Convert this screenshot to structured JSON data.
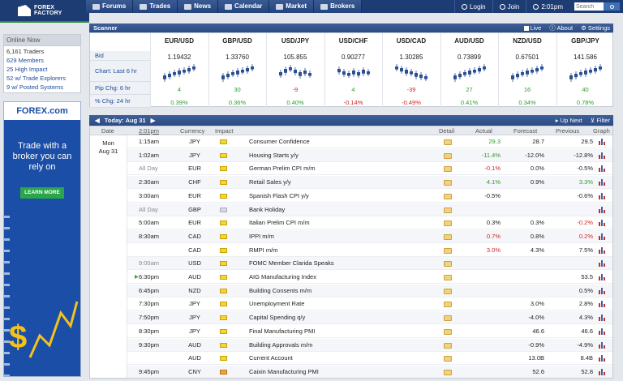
{
  "brand": {
    "line1": "FOREX",
    "line2": "FACTORY"
  },
  "nav": [
    {
      "label": "Forums",
      "icon": "forums-icon"
    },
    {
      "label": "Trades",
      "icon": "trades-icon"
    },
    {
      "label": "News",
      "icon": "news-icon"
    },
    {
      "label": "Calendar",
      "icon": "calendar-icon"
    },
    {
      "label": "Market",
      "icon": "market-icon"
    },
    {
      "label": "Brokers",
      "icon": "brokers-icon"
    }
  ],
  "topright": {
    "login": "Login",
    "join": "Join",
    "time": "2:01pm",
    "search_placeholder": "Search"
  },
  "online": {
    "heading": "Online Now",
    "items": [
      "6,161 Traders",
      "629 Members",
      "25 High Impact",
      "52 w/ Trade Explorers",
      "9 w/ Posted Systems"
    ]
  },
  "ad": {
    "brand": "FOREX.com",
    "text": "Trade with a broker you can rely on",
    "button": "LEARN MORE",
    "dollar": "$"
  },
  "scanner": {
    "title": "Scanner",
    "tools": [
      "Live",
      "About",
      "Settings"
    ],
    "row_labels": [
      "Bid",
      "Chart: Last 6 hr",
      "Pip Chg: 6 hr",
      "% Chg: 24 hr"
    ],
    "pairs": [
      {
        "name": "EUR/USD",
        "bid": "1.19432",
        "pip": "4",
        "pct": "0.39%",
        "dir": "pos"
      },
      {
        "name": "GBP/USD",
        "bid": "1.33760",
        "pip": "30",
        "pct": "0.36%",
        "dir": "pos"
      },
      {
        "name": "USD/JPY",
        "bid": "105.855",
        "pip": "-9",
        "pct": "0.40%",
        "dir": "mix"
      },
      {
        "name": "USD/CHF",
        "bid": "0.90277",
        "pip": "4",
        "pct": "-0.14%",
        "dir": "mix2"
      },
      {
        "name": "USD/CAD",
        "bid": "1.30285",
        "pip": "-39",
        "pct": "-0.49%",
        "dir": "neg"
      },
      {
        "name": "AUD/USD",
        "bid": "0.73899",
        "pip": "27",
        "pct": "0.41%",
        "dir": "pos"
      },
      {
        "name": "NZD/USD",
        "bid": "0.67501",
        "pip": "16",
        "pct": "0.34%",
        "dir": "pos"
      },
      {
        "name": "GBP/JPY",
        "bid": "141.586",
        "pip": "40",
        "pct": "0.78%",
        "dir": "pos"
      }
    ]
  },
  "calendar": {
    "today_label": "Today: Aug 31",
    "tools": [
      "Up Next",
      "Filter"
    ],
    "headers": {
      "date": "Date",
      "time": "2:01pm",
      "currency": "Currency",
      "impact": "Impact",
      "detail": "Detail",
      "actual": "Actual",
      "forecast": "Forecast",
      "previous": "Previous",
      "graph": "Graph"
    },
    "day": {
      "weekday": "Mon",
      "date": "Aug 31"
    },
    "rows": [
      {
        "time": "1:15am",
        "cur": "JPY",
        "imp": "med",
        "event": "Consumer Confidence",
        "actual": "29.3",
        "actual_dir": "pos",
        "forecast": "28.7",
        "previous": "29.5",
        "prev_dir": "",
        "detail": "open"
      },
      {
        "time": "1:02am",
        "cur": "JPY",
        "imp": "med",
        "event": "Housing Starts y/y",
        "actual": "-11.4%",
        "actual_dir": "pos",
        "forecast": "-12.0%",
        "previous": "-12.8%",
        "prev_dir": "",
        "detail": "alert"
      },
      {
        "time": "All Day",
        "cur": "EUR",
        "imp": "med",
        "event": "German Prelim CPI m/m",
        "actual": "-0.1%",
        "actual_dir": "neg",
        "forecast": "0.0%",
        "previous": "-0.5%",
        "prev_dir": "",
        "detail": "open"
      },
      {
        "time": "2:30am",
        "cur": "CHF",
        "imp": "med",
        "event": "Retail Sales y/y",
        "actual": "4.1%",
        "actual_dir": "pos",
        "forecast": "0.9%",
        "previous": "3.3%",
        "prev_dir": "pos",
        "detail": "open"
      },
      {
        "time": "3:00am",
        "cur": "EUR",
        "imp": "med",
        "event": "Spanish Flash CPI y/y",
        "actual": "-0.5%",
        "actual_dir": "",
        "forecast": "",
        "previous": "-0.6%",
        "prev_dir": "",
        "detail": "open"
      },
      {
        "time": "All Day",
        "cur": "GBP",
        "imp": "low",
        "event": "Bank Holiday",
        "actual": "",
        "actual_dir": "",
        "forecast": "",
        "previous": "",
        "prev_dir": "",
        "detail": "open"
      },
      {
        "time": "5:00am",
        "cur": "EUR",
        "imp": "med",
        "event": "Italian Prelim CPI m/m",
        "actual": "0.3%",
        "actual_dir": "",
        "forecast": "0.3%",
        "previous": "-0.2%",
        "prev_dir": "neg",
        "detail": "open"
      },
      {
        "time": "8:30am",
        "cur": "CAD",
        "imp": "med",
        "event": "IPPI m/m",
        "actual": "0.7%",
        "actual_dir": "neg",
        "forecast": "0.8%",
        "previous": "0.2%",
        "prev_dir": "neg",
        "detail": "open"
      },
      {
        "time": "",
        "cur": "CAD",
        "imp": "med",
        "event": "RMPI m/m",
        "actual": "3.0%",
        "actual_dir": "neg",
        "forecast": "4.3%",
        "previous": "7.5%",
        "prev_dir": "",
        "detail": "open"
      },
      {
        "time": "9:00am",
        "cur": "USD",
        "imp": "med",
        "event": "FOMC Member Clarida Speaks",
        "actual": "",
        "actual_dir": "",
        "forecast": "",
        "previous": "",
        "prev_dir": "",
        "detail": "open"
      },
      {
        "time": "6:30pm",
        "cur": "AUD",
        "imp": "med",
        "event": "AIG Manufacturing Index",
        "actual": "",
        "actual_dir": "",
        "forecast": "",
        "previous": "53.5",
        "prev_dir": "",
        "detail": "open",
        "next": true
      },
      {
        "time": "6:45pm",
        "cur": "NZD",
        "imp": "med",
        "event": "Building Consents m/m",
        "actual": "",
        "actual_dir": "",
        "forecast": "",
        "previous": "0.5%",
        "prev_dir": "",
        "detail": "open"
      },
      {
        "time": "7:30pm",
        "cur": "JPY",
        "imp": "med",
        "event": "Unemployment Rate",
        "actual": "",
        "actual_dir": "",
        "forecast": "3.0%",
        "previous": "2.8%",
        "prev_dir": "",
        "detail": "open"
      },
      {
        "time": "7:50pm",
        "cur": "JPY",
        "imp": "med",
        "event": "Capital Spending q/y",
        "actual": "",
        "actual_dir": "",
        "forecast": "-4.0%",
        "previous": "4.3%",
        "prev_dir": "",
        "detail": "open"
      },
      {
        "time": "8:30pm",
        "cur": "JPY",
        "imp": "med",
        "event": "Final Manufacturing PMI",
        "actual": "",
        "actual_dir": "",
        "forecast": "46.6",
        "previous": "46.6",
        "prev_dir": "",
        "detail": "open"
      },
      {
        "time": "9:30pm",
        "cur": "AUD",
        "imp": "med",
        "event": "Building Approvals m/m",
        "actual": "",
        "actual_dir": "",
        "forecast": "-0.9%",
        "previous": "-4.9%",
        "prev_dir": "",
        "detail": "open"
      },
      {
        "time": "",
        "cur": "AUD",
        "imp": "med",
        "event": "Current Account",
        "actual": "",
        "actual_dir": "",
        "forecast": "13.0B",
        "previous": "8.4B",
        "prev_dir": "",
        "detail": "open"
      },
      {
        "time": "9:45pm",
        "cur": "CNY",
        "imp": "hi",
        "event": "Caixin Manufacturing PMI",
        "actual": "",
        "actual_dir": "",
        "forecast": "52.6",
        "previous": "52.8",
        "prev_dir": "",
        "detail": "open"
      }
    ]
  }
}
